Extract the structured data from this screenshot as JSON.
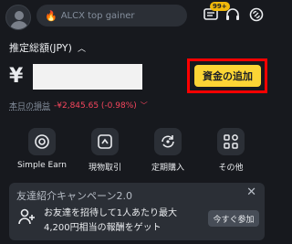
{
  "header": {
    "search_placeholder": "ALCX top gainer",
    "search_icon": "fire-icon",
    "notification_badge": "99+",
    "icons": [
      "avatar",
      "message-icon",
      "headset-icon",
      "referral-icon"
    ]
  },
  "balance": {
    "label": "推定総額(JPY)",
    "currency_symbol": "¥",
    "add_funds_label": "資金の追加",
    "pnl_label": "本日の損益",
    "pnl_value": "-¥2,845.65 (-0.98%)"
  },
  "quick_actions": [
    {
      "label": "Simple Earn",
      "icon": "coin-earn-icon"
    },
    {
      "label": "現物取引",
      "icon": "spot-trade-icon"
    },
    {
      "label": "定期購入",
      "icon": "recurring-buy-icon"
    },
    {
      "label": "その他",
      "icon": "more-grid-icon"
    }
  ],
  "promo": {
    "title": "友達紹介キャンペーン2.0",
    "line1": "お友達を招待して1人あたり最大",
    "line2": "4,200円相当の報酬をゲット",
    "button": "今すぐ参加",
    "close": "✕"
  },
  "colors": {
    "background": "#17191e",
    "accent": "#fcd535",
    "negative": "#f6465d",
    "highlight": "#ff0000"
  }
}
